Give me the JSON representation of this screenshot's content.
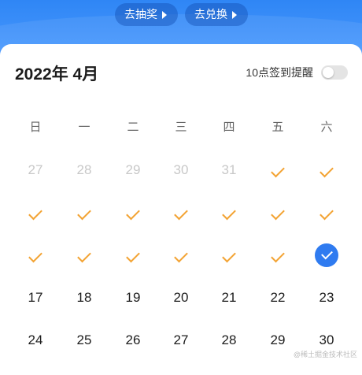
{
  "banner": {
    "lottery_label": "去抽奖",
    "exchange_label": "去兑换"
  },
  "calendar": {
    "title": "2022年 4月",
    "reminder_label": "10点签到提醒",
    "reminder_on": false,
    "weekdays": [
      "日",
      "一",
      "二",
      "三",
      "四",
      "五",
      "六"
    ],
    "weeks": [
      [
        {
          "text": "27",
          "state": "muted"
        },
        {
          "text": "28",
          "state": "muted"
        },
        {
          "text": "29",
          "state": "muted"
        },
        {
          "text": "30",
          "state": "muted"
        },
        {
          "text": "31",
          "state": "muted"
        },
        {
          "text": "",
          "state": "checked"
        },
        {
          "text": "",
          "state": "checked"
        }
      ],
      [
        {
          "text": "",
          "state": "checked"
        },
        {
          "text": "",
          "state": "checked"
        },
        {
          "text": "",
          "state": "checked"
        },
        {
          "text": "",
          "state": "checked"
        },
        {
          "text": "",
          "state": "checked"
        },
        {
          "text": "",
          "state": "checked"
        },
        {
          "text": "",
          "state": "checked"
        }
      ],
      [
        {
          "text": "",
          "state": "checked"
        },
        {
          "text": "",
          "state": "checked"
        },
        {
          "text": "",
          "state": "checked"
        },
        {
          "text": "",
          "state": "checked"
        },
        {
          "text": "",
          "state": "checked"
        },
        {
          "text": "",
          "state": "checked"
        },
        {
          "text": "",
          "state": "today-checked"
        }
      ],
      [
        {
          "text": "17",
          "state": "normal"
        },
        {
          "text": "18",
          "state": "normal"
        },
        {
          "text": "19",
          "state": "normal"
        },
        {
          "text": "20",
          "state": "normal"
        },
        {
          "text": "21",
          "state": "normal"
        },
        {
          "text": "22",
          "state": "normal"
        },
        {
          "text": "23",
          "state": "normal"
        }
      ],
      [
        {
          "text": "24",
          "state": "normal"
        },
        {
          "text": "25",
          "state": "normal"
        },
        {
          "text": "26",
          "state": "normal"
        },
        {
          "text": "27",
          "state": "normal"
        },
        {
          "text": "28",
          "state": "normal"
        },
        {
          "text": "29",
          "state": "normal"
        },
        {
          "text": "30",
          "state": "normal"
        }
      ]
    ]
  },
  "watermark": "@稀土掘金技术社区",
  "colors": {
    "accent_blue": "#2f7bf0",
    "check_orange": "#f3a333",
    "banner_blue": "#2f86f5"
  }
}
